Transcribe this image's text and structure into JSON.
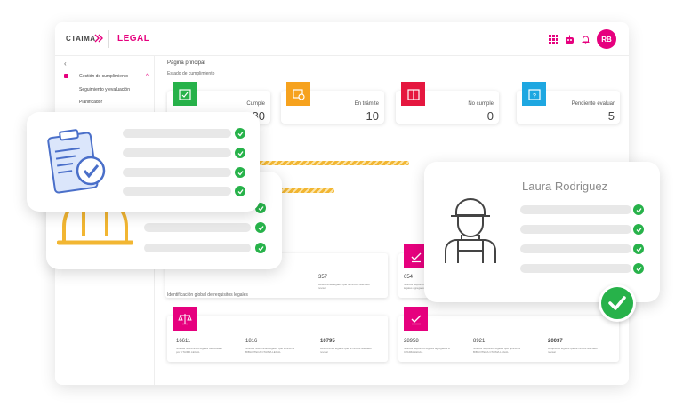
{
  "header": {
    "logo_text": "CTAIMA",
    "brand": "LEGAL",
    "avatar_initials": "RB",
    "accent_color": "#e6007e"
  },
  "sidebar": {
    "back": "‹",
    "items": [
      {
        "label": "Gestión de cumplimiento"
      },
      {
        "label": "Seguimiento y evaluación"
      },
      {
        "label": "Planificador"
      }
    ]
  },
  "main": {
    "page_title": "Página principal",
    "subtitle": "Estado de cumplimiento",
    "status_cards": [
      {
        "label": "Cumple",
        "value": "80",
        "color": "#27b24a",
        "icon": "calendar-check-icon"
      },
      {
        "label": "En trámite",
        "value": "10",
        "color": "#f6a21e",
        "icon": "calendar-clock-icon"
      },
      {
        "label": "No cumple",
        "value": "0",
        "color": "#e5173f",
        "icon": "calendar-x-icon"
      },
      {
        "label": "Pendiente evaluar",
        "value": "5",
        "color": "#1ea7e1",
        "icon": "calendar-question-icon"
      }
    ],
    "mid_cards": [
      {
        "value": "357",
        "desc": "Referencias legales que te hemos afectado revisar"
      },
      {
        "value": "654",
        "desc": "Nuevos requisitos legales agregados a"
      }
    ],
    "section2_title": "Identificación global de requisitos legales",
    "global_cards": [
      {
        "icon": "scale-icon",
        "stats": [
          {
            "value": "16611",
            "desc": "Nuevas referencias legales detectadas por CTAIMA LEGAL"
          },
          {
            "value": "1816",
            "desc": "Nuevas referencias legales que aplican a BIBLIOTECA CTAIMA LEGAL"
          },
          {
            "value": "10795",
            "desc": "Referencias legales que te hemos afectado revisar"
          }
        ]
      },
      {
        "icon": "check-box-icon",
        "stats": [
          {
            "value": "28958",
            "desc": "Nuevos requisitos legales agregados a CTAIMA LEGAL"
          },
          {
            "value": "8921",
            "desc": "Nuevos requisitos legales que aplican a BIBLIOTECA CTAIMA LEGAL"
          },
          {
            "value": "20037",
            "desc": "Requisitos legales que te hemos afectado revisar"
          }
        ]
      }
    ]
  },
  "overlay": {
    "person_name": "Laura Rodriguez",
    "check_color": "#27b24a",
    "hard_hat_color": "#f2b632"
  }
}
